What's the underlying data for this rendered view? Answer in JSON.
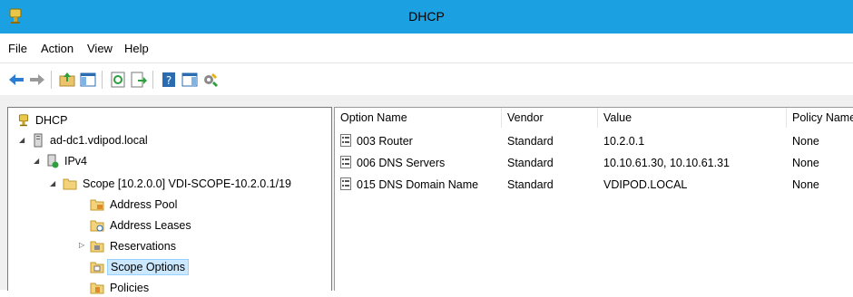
{
  "window": {
    "title": "DHCP"
  },
  "menu": [
    "File",
    "Action",
    "View",
    "Help"
  ],
  "toolbar": {
    "icons": [
      "back-arrow-icon",
      "forward-arrow-icon",
      "up-folder-icon",
      "show-hide-console-tree-icon",
      "refresh-icon",
      "export-list-icon",
      "help-icon",
      "show-hide-action-pane-icon",
      "dhcp-icon"
    ]
  },
  "tree": {
    "root": "DHCP",
    "server": "ad-dc1.vdipod.local",
    "ipv4": "IPv4",
    "scope": "Scope [10.2.0.0] VDI-SCOPE-10.2.0.1/19",
    "items": [
      "Address Pool",
      "Address Leases",
      "Reservations",
      "Scope Options",
      "Policies"
    ],
    "selected": "Scope Options"
  },
  "list": {
    "columns": [
      "Option Name",
      "Vendor",
      "Value",
      "Policy Name"
    ],
    "rows": [
      {
        "name": "003 Router",
        "vendor": "Standard",
        "value": "10.2.0.1",
        "policy": "None"
      },
      {
        "name": "006 DNS Servers",
        "vendor": "Standard",
        "value": "10.10.61.30, 10.10.61.31",
        "policy": "None"
      },
      {
        "name": "015 DNS Domain Name",
        "vendor": "Standard",
        "value": "VDIPOD.LOCAL",
        "policy": "None"
      }
    ]
  },
  "colors": {
    "titlebar": "#1ba1e2",
    "selection": "#cce8ff"
  }
}
